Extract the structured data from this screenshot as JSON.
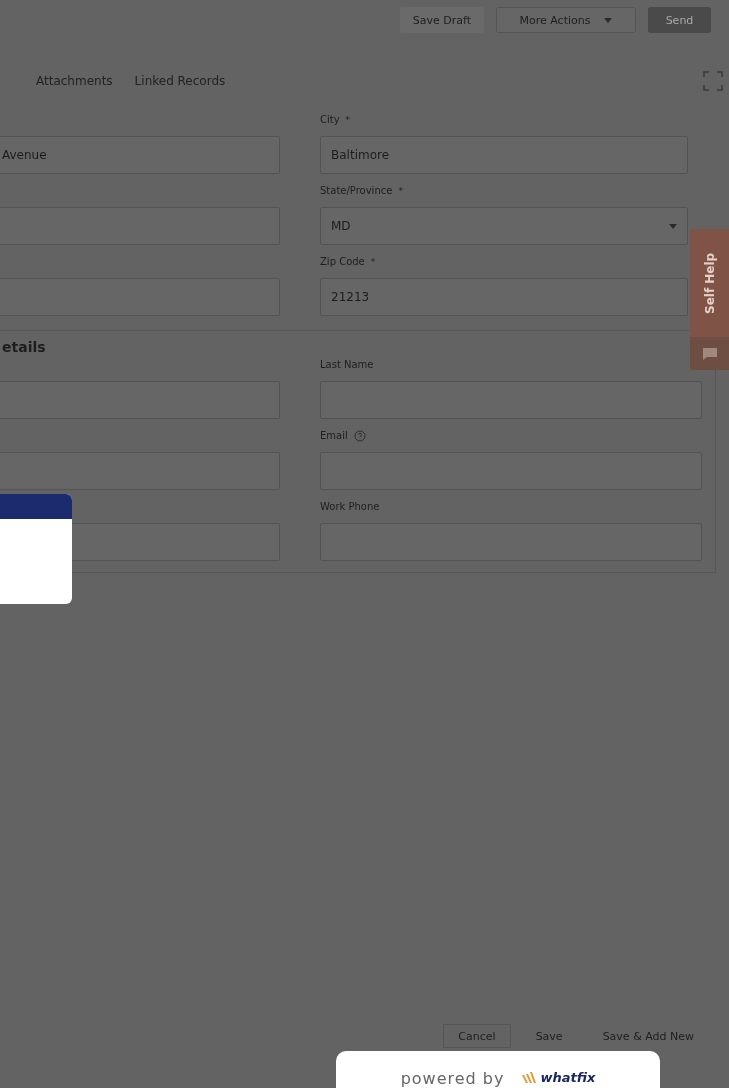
{
  "header_buttons": [
    {
      "label": "Save Draft",
      "kind": "plain"
    },
    {
      "label": "More Actions",
      "kind": "dropdown"
    },
    {
      "label": "Send",
      "kind": "primary"
    }
  ],
  "tabs": [
    {
      "label": "Attachments"
    },
    {
      "label": "Linked Records"
    }
  ],
  "address": {
    "left_fields": [
      {
        "kind": "input",
        "value": "Avenue"
      },
      {
        "kind": "input"
      },
      {
        "kind": "input"
      }
    ],
    "right_fields": [
      {
        "kind": "input",
        "label": "City",
        "marker": "*",
        "value": "Baltimore"
      },
      {
        "kind": "select",
        "label": "State/Province",
        "marker": "*",
        "value": "MD"
      },
      {
        "kind": "input",
        "label": "Zip Code",
        "marker": "*",
        "value": "21213"
      }
    ]
  },
  "contact": {
    "heading": "etails",
    "left_fields": [
      {
        "kind": "input"
      },
      {
        "kind": "input"
      },
      {
        "kind": "input"
      }
    ],
    "right_fields": [
      {
        "kind": "input",
        "label": "Last Name",
        "help": false
      },
      {
        "kind": "input",
        "label": "Email",
        "help": true
      },
      {
        "kind": "input",
        "label": "Work Phone",
        "help": false
      }
    ]
  },
  "footer_buttons": [
    {
      "label": "Cancel",
      "kind": "outlined"
    },
    {
      "label": "Save",
      "kind": "plain"
    },
    {
      "label": "Save & Add New",
      "kind": "plain"
    }
  ],
  "self_help": {
    "label": "Self Help"
  },
  "powered_by": {
    "prefix": "powered by",
    "brand": "whatfix"
  }
}
